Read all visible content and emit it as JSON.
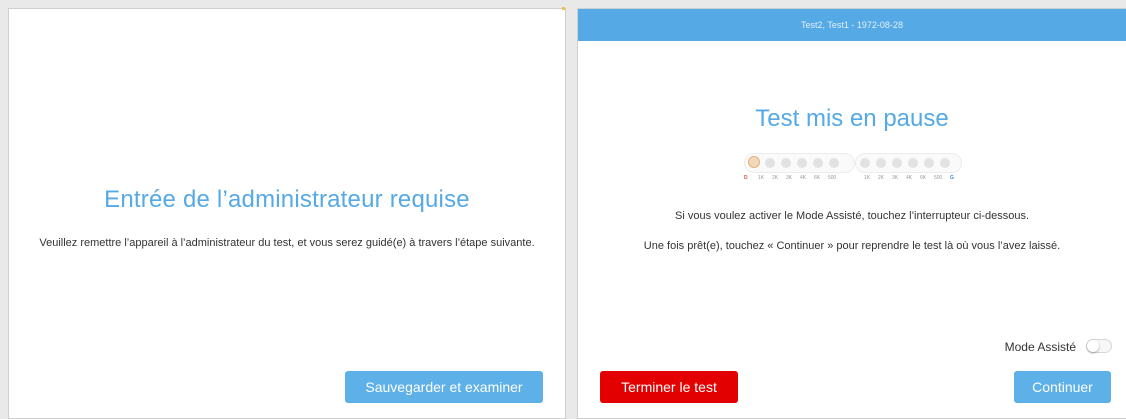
{
  "left_panel": {
    "title": "Entrée de l’administrateur requise",
    "message": "Veuillez remettre l’appareil à l’administrateur du test, et vous serez guidé(e) à travers l’étape suivante.",
    "save_button": "Sauvegarder et examiner"
  },
  "right_panel": {
    "header": "Test2, Test1 - 1972-08-28",
    "title": "Test mis en pause",
    "audiogram": {
      "left_ear": "D",
      "right_ear": "G",
      "left_freqs": [
        "1K",
        "2K",
        "3K",
        "4K",
        "6K",
        "500"
      ],
      "right_freqs": [
        "1K",
        "2K",
        "3K",
        "4K",
        "6K",
        "500"
      ],
      "active_index": 0
    },
    "message1": "Si vous voulez activer le Mode Assisté, touchez l’interrupteur ci-dessous.",
    "message2": "Une fois prêt(e), touchez « Continuer » pour reprendre le test là où vous l’avez laissé.",
    "assist_label": "Mode Assisté",
    "assist_on": false,
    "end_button": "Terminer le test",
    "continue_button": "Continuer"
  },
  "colors": {
    "accent": "#55a9e5",
    "danger": "#e30000"
  }
}
